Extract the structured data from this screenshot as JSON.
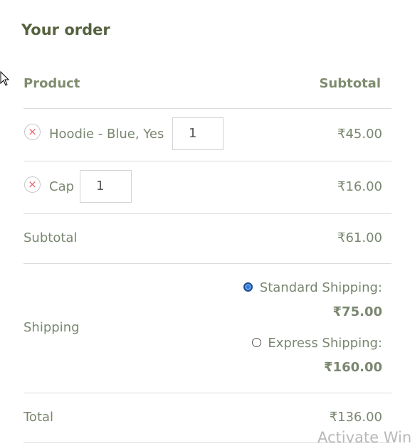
{
  "order": {
    "title": "Your order",
    "headers": {
      "product": "Product",
      "subtotal": "Subtotal"
    },
    "items": [
      {
        "name": "Hoodie - Blue, Yes",
        "quantity": "1",
        "price": "₹45.00",
        "remove_symbol": "×"
      },
      {
        "name": "Cap",
        "quantity": "1",
        "price": "₹16.00",
        "remove_symbol": "×"
      }
    ],
    "subtotal": {
      "label": "Subtotal",
      "value": "₹61.00"
    },
    "shipping": {
      "label": "Shipping",
      "options": [
        {
          "label": "Standard Shipping:",
          "price": "₹75.00",
          "selected": true
        },
        {
          "label": "Express Shipping:",
          "price": "₹160.00",
          "selected": false
        }
      ]
    },
    "total": {
      "label": "Total",
      "value": "₹136.00"
    }
  },
  "watermark": "Activate Win",
  "colors": {
    "heading": "#56623f",
    "text": "#7a8770",
    "remove_icon": "#e8606b",
    "radio_selected": "#2d7be0"
  }
}
